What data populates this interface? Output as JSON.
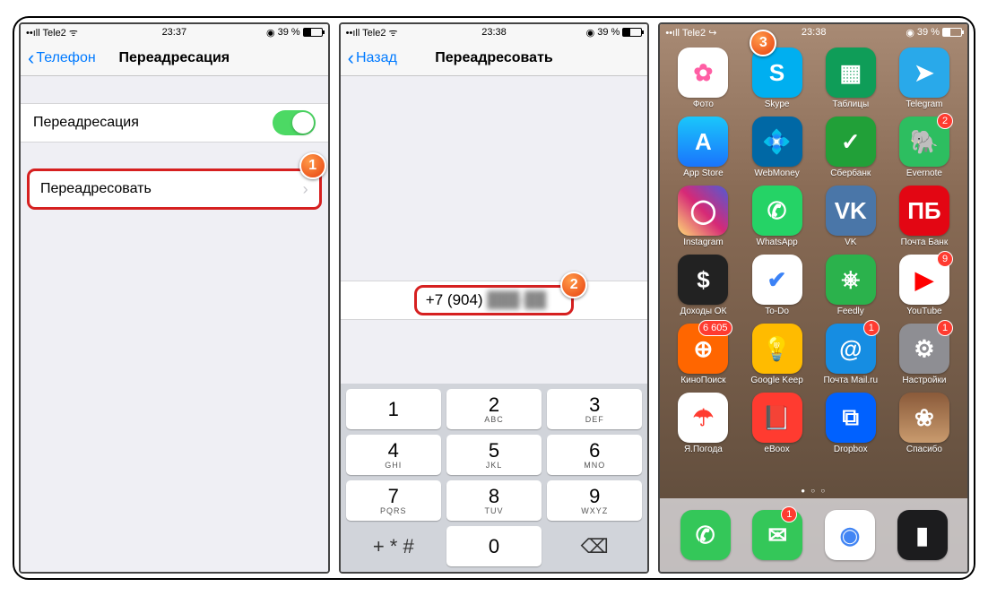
{
  "markers": {
    "m1": "1",
    "m2": "2",
    "m3": "3"
  },
  "s1": {
    "status": {
      "carrier": "••ıll Tele2 ᯤ",
      "time": "23:37",
      "batt": "39 %",
      "loc": "◉"
    },
    "back": "Телефон",
    "title": "Переадресация",
    "toggle_label": "Переадресация",
    "forward_label": "Переадресовать"
  },
  "s2": {
    "status": {
      "carrier": "••ıll Tele2 ᯤ",
      "time": "23:38",
      "batt": "39 %",
      "loc": "◉"
    },
    "back": "Назад",
    "title": "Переадресовать",
    "number_prefix": "+7 (904)",
    "number_rest": " ███-██",
    "keys": [
      {
        "n": "1",
        "l": ""
      },
      {
        "n": "2",
        "l": "ABC"
      },
      {
        "n": "3",
        "l": "DEF"
      },
      {
        "n": "4",
        "l": "GHI"
      },
      {
        "n": "5",
        "l": "JKL"
      },
      {
        "n": "6",
        "l": "MNO"
      },
      {
        "n": "7",
        "l": "PQRS"
      },
      {
        "n": "8",
        "l": "TUV"
      },
      {
        "n": "9",
        "l": "WXYZ"
      }
    ],
    "sym": "+ * #",
    "zero": "0",
    "del": "⌫"
  },
  "s3": {
    "status": {
      "carrier": "••ıll Tele2  ↪",
      "time": "23:38",
      "batt": "39 %",
      "loc": "◉"
    },
    "apps": [
      {
        "name": "Фото",
        "bg": "linear-gradient(#fff,#fff)",
        "glyph": "✿",
        "gc": "#ff5ea4"
      },
      {
        "name": "Skype",
        "bg": "#00aff0",
        "glyph": "S"
      },
      {
        "name": "Таблицы",
        "bg": "#0f9d58",
        "glyph": "▦"
      },
      {
        "name": "Telegram",
        "bg": "#29a9ea",
        "glyph": "➤"
      },
      {
        "name": "App Store",
        "bg": "linear-gradient(#1ac7fb,#1a74fc)",
        "glyph": "A"
      },
      {
        "name": "WebMoney",
        "bg": "#0068a5",
        "glyph": "💠"
      },
      {
        "name": "Сбербанк",
        "bg": "#21a038",
        "glyph": "✓"
      },
      {
        "name": "Evernote",
        "bg": "#2dbe60",
        "glyph": "🐘",
        "badge": "2"
      },
      {
        "name": "Instagram",
        "bg": "linear-gradient(45deg,#feda75,#d62976,#4f5bd5)",
        "glyph": "◯"
      },
      {
        "name": "WhatsApp",
        "bg": "#25d366",
        "glyph": "✆"
      },
      {
        "name": "VK",
        "bg": "#4a76a8",
        "glyph": "VK"
      },
      {
        "name": "Почта Банк",
        "bg": "#e30613",
        "glyph": "ПБ"
      },
      {
        "name": "Доходы ОК",
        "bg": "#222",
        "glyph": "$"
      },
      {
        "name": "To-Do",
        "bg": "#fff",
        "glyph": "✔",
        "gc": "#3b82f6"
      },
      {
        "name": "Feedly",
        "bg": "#2bb24c",
        "glyph": "⎈"
      },
      {
        "name": "YouTube",
        "bg": "#fff",
        "glyph": "▶",
        "gc": "#ff0000",
        "badge": "9"
      },
      {
        "name": "КиноПоиск",
        "bg": "#ff6600",
        "glyph": "⊕",
        "badge": "6 605"
      },
      {
        "name": "Google Keep",
        "bg": "#ffbb00",
        "glyph": "💡"
      },
      {
        "name": "Почта Mail.ru",
        "bg": "#168de2",
        "glyph": "@",
        "badge": "1"
      },
      {
        "name": "Настройки",
        "bg": "#8e8e93",
        "glyph": "⚙",
        "badge": "1"
      },
      {
        "name": "Я.Погода",
        "bg": "#fff",
        "glyph": "☂",
        "gc": "#ff3b30"
      },
      {
        "name": "eBoox",
        "bg": "#ff3b30",
        "glyph": "📕"
      },
      {
        "name": "Dropbox",
        "bg": "#0061ff",
        "glyph": "⧉"
      },
      {
        "name": "Спасибо",
        "bg": "linear-gradient(#8a5a3a,#c99b6e)",
        "glyph": "❀"
      }
    ],
    "dock": [
      {
        "name": "phone",
        "bg": "#34c759",
        "glyph": "✆"
      },
      {
        "name": "messages",
        "bg": "#34c759",
        "glyph": "✉",
        "badge": "1"
      },
      {
        "name": "chrome",
        "bg": "#fff",
        "glyph": "◉",
        "gc": "#4285f4"
      },
      {
        "name": "wallet",
        "bg": "#1c1c1e",
        "glyph": "▮"
      }
    ]
  }
}
